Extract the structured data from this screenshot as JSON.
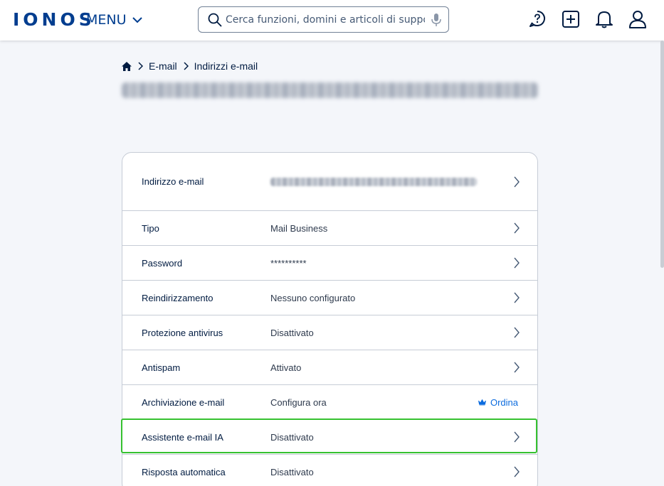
{
  "header": {
    "logo": "IONOS",
    "menu_label": "MENU",
    "search_placeholder": "Cerca funzioni, domini e articoli di supporto"
  },
  "breadcrumb": {
    "items": [
      "E-mail",
      "Indirizzi e-mail"
    ]
  },
  "settings": {
    "rows": [
      {
        "label": "Indirizzo e-mail",
        "value": ""
      },
      {
        "label": "Tipo",
        "value": "Mail Business"
      },
      {
        "label": "Password",
        "value": "**********"
      },
      {
        "label": "Reindirizzamento",
        "value": "Nessuno configurato"
      },
      {
        "label": "Protezione antivirus",
        "value": "Disattivato"
      },
      {
        "label": "Antispam",
        "value": "Attivato"
      },
      {
        "label": "Archiviazione e-mail",
        "value": "Configura ora",
        "action": "Ordina"
      },
      {
        "label": "Assistente e-mail IA",
        "value": "Disattivato"
      },
      {
        "label": "Risposta automatica",
        "value": "Disattivato"
      }
    ]
  },
  "colors": {
    "brand": "#003d8f",
    "link": "#0b6bde",
    "highlight": "#36c130"
  }
}
